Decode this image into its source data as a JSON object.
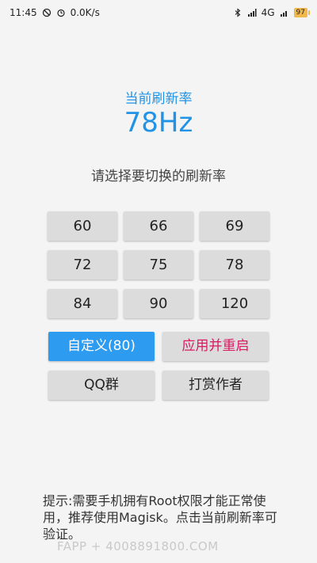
{
  "status_bar": {
    "time": "11:45",
    "net_speed": "0.0K/s",
    "network": "4G",
    "battery": "97"
  },
  "current": {
    "label": "当前刷新率",
    "value": "78Hz"
  },
  "choose_label": "请选择要切换的刷新率",
  "rates": [
    "60",
    "66",
    "69",
    "72",
    "75",
    "78",
    "84",
    "90",
    "120"
  ],
  "actions": {
    "custom": "自定义(80)",
    "apply": "应用并重启",
    "qq_group": "QQ群",
    "donate": "打赏作者"
  },
  "hint": "提示:需要手机拥有Root权限才能正常使用，推荐使用Magisk。点击当前刷新率可验证。",
  "watermark": "FAPP + 4008891800.COM",
  "colors": {
    "accent": "#2193e6",
    "custom_button": "#2d9cf0",
    "apply_text": "#d81b60"
  }
}
